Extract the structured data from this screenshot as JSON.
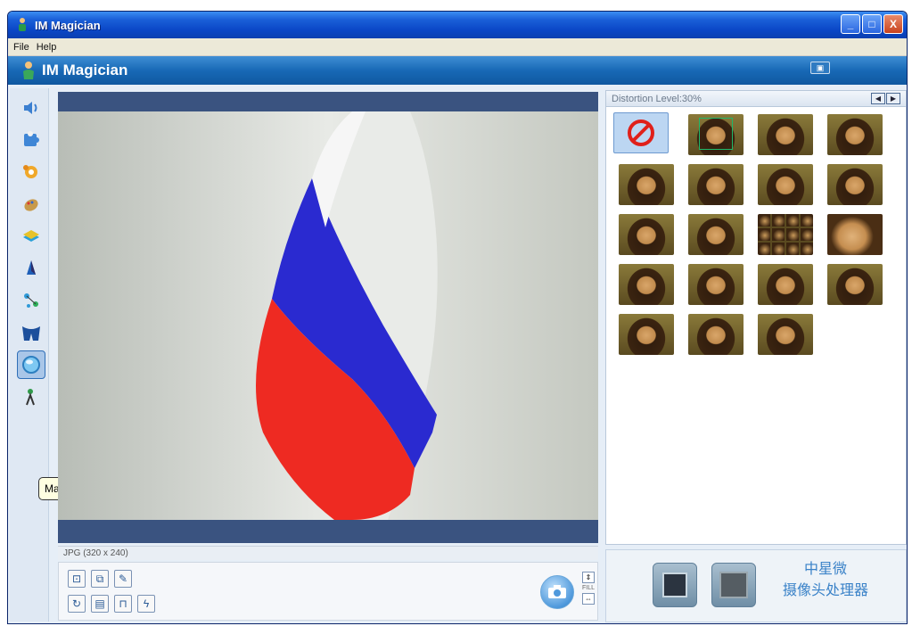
{
  "window": {
    "title": "IM Magician",
    "buttons": [
      "_",
      "□",
      "X"
    ]
  },
  "menu": {
    "items": [
      "File",
      "Help"
    ]
  },
  "banner": {
    "title": "IM Magician"
  },
  "toolbar": {
    "tools": [
      {
        "name": "tool-sound",
        "icon": "speaker-icon"
      },
      {
        "name": "tool-puzzle",
        "icon": "puzzle-icon"
      },
      {
        "name": "tool-gear",
        "icon": "gear-icon"
      },
      {
        "name": "tool-palette",
        "icon": "palette-icon"
      },
      {
        "name": "tool-layers",
        "icon": "layers-icon"
      },
      {
        "name": "tool-shape",
        "icon": "shape-icon"
      },
      {
        "name": "tool-molecule",
        "icon": "molecule-icon"
      },
      {
        "name": "tool-mask",
        "icon": "mask-icon"
      },
      {
        "name": "tool-magic-mirror",
        "icon": "mirror-icon",
        "active": true
      },
      {
        "name": "tool-figure",
        "icon": "figure-icon"
      }
    ],
    "tooltip": "Magic Mirror"
  },
  "video": {
    "status": "JPG (320 x 240)"
  },
  "controls": {
    "fill_label": "FILL"
  },
  "panel": {
    "distortion_label": "Distortion Level:30%",
    "nav_prev": "◀",
    "nav_next": "▶"
  },
  "effects": [
    "none",
    "mona-1",
    "mona-2",
    "mona-3",
    "mona-4",
    "mona-5",
    "mona-6",
    "mona-7",
    "mona-8",
    "mona-9",
    "mona-multi",
    "mona-zoom",
    "mona-10",
    "mona-11",
    "mona-12",
    "mona-13",
    "mona-14",
    "mona-15",
    "mona-16"
  ],
  "promo": {
    "line1": "中星微",
    "line2": "摄像头处理器"
  },
  "colors": {
    "titlebar": "#0a46c6",
    "banner": "#1869b6",
    "accent": "#3a82c8"
  }
}
